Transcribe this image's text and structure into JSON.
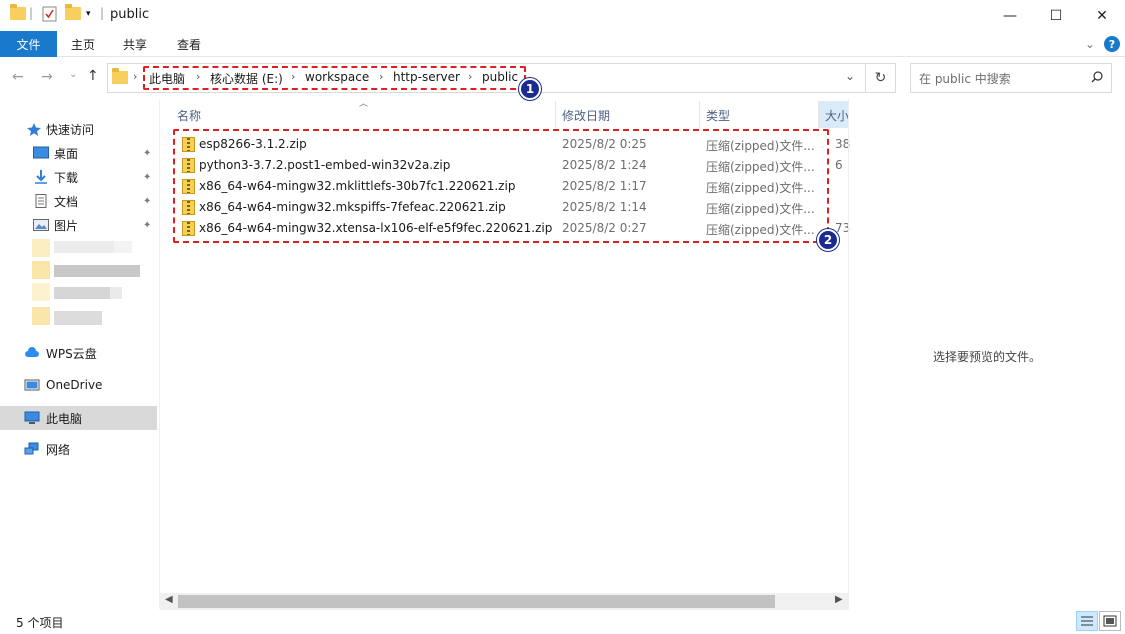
{
  "window": {
    "title": "public",
    "minimize_glyph": "—",
    "maximize_glyph": "☐",
    "close_glyph": "✕"
  },
  "ribbon": {
    "tabs": [
      "文件",
      "主页",
      "共享",
      "查看"
    ],
    "help_glyph": "?",
    "expand_glyph": "⌄"
  },
  "nav": {
    "back_glyph": "←",
    "forward_glyph": "→",
    "recent_glyph": "⌄",
    "up_glyph": "↑"
  },
  "address": {
    "breadcrumbs": [
      "此电脑",
      "核心数据 (E:)",
      "workspace",
      "http-server",
      "public"
    ],
    "separator": "›",
    "refresh_glyph": "↻",
    "dropdown_glyph": "⌄"
  },
  "search": {
    "placeholder": "在 public 中搜索"
  },
  "sidebar": {
    "quick_access": "快速访问",
    "items": [
      {
        "label": "桌面",
        "icon": "desktop-icon",
        "pinned": true
      },
      {
        "label": "下载",
        "icon": "download-icon",
        "pinned": true
      },
      {
        "label": "文档",
        "icon": "document-icon",
        "pinned": true
      },
      {
        "label": "图片",
        "icon": "picture-icon",
        "pinned": true
      }
    ],
    "wps": "WPS云盘",
    "onedrive": "OneDrive",
    "this_pc": "此电脑",
    "network": "网络",
    "pin_glyph": "📌"
  },
  "columns": {
    "name": "名称",
    "modified": "修改日期",
    "type": "类型",
    "size": "大小"
  },
  "files": [
    {
      "name": "esp8266-3.1.2.zip",
      "modified": "2025/8/2 0:25",
      "type": "压缩(zipped)文件...",
      "size": "38"
    },
    {
      "name": "python3-3.7.2.post1-embed-win32v2a.zip",
      "modified": "2025/8/2 1:24",
      "type": "压缩(zipped)文件...",
      "size": "6"
    },
    {
      "name": "x86_64-w64-mingw32.mklittlefs-30b7fc1.220621.zip",
      "modified": "2025/8/2 1:17",
      "type": "压缩(zipped)文件...",
      "size": ""
    },
    {
      "name": "x86_64-w64-mingw32.mkspiffs-7fefeac.220621.zip",
      "modified": "2025/8/2 1:14",
      "type": "压缩(zipped)文件...",
      "size": ""
    },
    {
      "name": "x86_64-w64-mingw32.xtensa-lx106-elf-e5f9fec.220621.zip",
      "modified": "2025/8/2 0:27",
      "type": "压缩(zipped)文件...",
      "size": "73"
    }
  ],
  "preview": {
    "message": "选择要预览的文件。"
  },
  "annotations": {
    "badge1": "1",
    "badge2": "2"
  },
  "status": {
    "item_count": "5 个项目"
  },
  "colors": {
    "accent": "#1979ca",
    "annotation_red": "#e02020",
    "badge_navy": "#1a2a8e"
  }
}
